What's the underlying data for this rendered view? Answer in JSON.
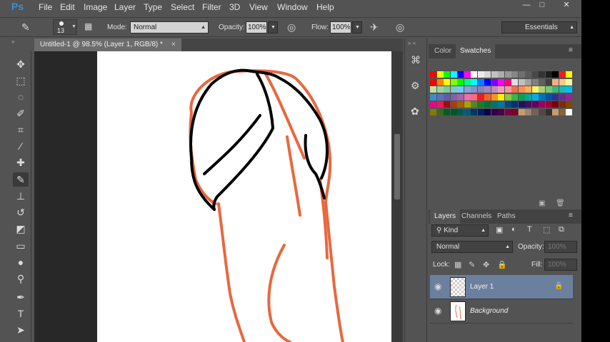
{
  "app": {
    "logo": "Ps"
  },
  "menu": [
    "File",
    "Edit",
    "Image",
    "Layer",
    "Type",
    "Select",
    "Filter",
    "3D",
    "View",
    "Window",
    "Help"
  ],
  "window_controls": {
    "minimize": "—",
    "maximize": "□",
    "close": "✕"
  },
  "options": {
    "brush_size": "13",
    "mode_label": "Mode:",
    "mode_value": "Normal",
    "opacity_label": "Opacity:",
    "opacity_value": "100%",
    "flow_label": "Flow:",
    "flow_value": "100%",
    "workspace": "Essentials"
  },
  "document": {
    "tab_title": "Untitled-1 @ 98.5% (Layer 1, RGB/8) *",
    "close": "×"
  },
  "panels": {
    "color_tab": "Color",
    "swatches_tab": "Swatches",
    "layers_tab": "Layers",
    "channels_tab": "Channels",
    "paths_tab": "Paths",
    "kind_label": "Kind",
    "blend_mode": "Normal",
    "opacity_label": "Opacity:",
    "opacity_value": "100%",
    "lock_label": "Lock:",
    "fill_label": "Fill:",
    "fill_value": "100%"
  },
  "layers": [
    {
      "name": "Layer 1",
      "selected": true
    },
    {
      "name": "Background",
      "selected": false
    }
  ],
  "colors": {
    "accent_selected_layer": "#6b7f9e",
    "stroke_orange": "#e8683f",
    "stroke_black": "#000000"
  },
  "swatch_rows": [
    [
      "#ff0000",
      "#ffff00",
      "#00ff00",
      "#00ffff",
      "#0000ff",
      "#ff00ff",
      "#ffffff",
      "#ebebeb",
      "#d6d6d6",
      "#c2c2c2",
      "#adadad",
      "#999999",
      "#858585",
      "#707070",
      "#5c5c5c",
      "#474747",
      "#333333",
      "#1e1e1e",
      "#000000",
      "#ed1c24",
      "#ffff00"
    ],
    [
      "#ff0000",
      "#ff8000",
      "#ffff00",
      "#80ff00",
      "#00ff00",
      "#00ff80",
      "#00ffff",
      "#0080ff",
      "#0000ff",
      "#8000ff",
      "#ff00ff",
      "#ff0080",
      "#e0e0e0",
      "#c0c0c0",
      "#a0a0a0",
      "#808080",
      "#606060",
      "#404040",
      "#f9ad81",
      "#fdc68a",
      "#fff79a"
    ],
    [
      "#c4df9b",
      "#a3d39c",
      "#82ca9d",
      "#7accc8",
      "#6dcff6",
      "#7da7d8",
      "#8393ca",
      "#8781bd",
      "#a187be",
      "#bd8cbf",
      "#f49ac1",
      "#f5989d",
      "#f26c4f",
      "#f68e56",
      "#fbaf5d",
      "#fff467",
      "#acd373",
      "#7cc576",
      "#3bb878",
      "#1abbb4",
      "#00bff3"
    ],
    [
      "#438ccb",
      "#5574b9",
      "#605ca8",
      "#855fa8",
      "#a763a8",
      "#f06eaa",
      "#f26d7d",
      "#ed1c24",
      "#f26522",
      "#f7941d",
      "#fff200",
      "#8dc63f",
      "#39b54a",
      "#00a651",
      "#00a99d",
      "#00aeef",
      "#0072bc",
      "#0054a6",
      "#2e3192",
      "#662d91",
      "#92278f"
    ],
    [
      "#ec008c",
      "#ed145b",
      "#9e0b0f",
      "#a0410d",
      "#a36209",
      "#aba000",
      "#598527",
      "#1a7b30",
      "#007236",
      "#00746b",
      "#0076a3",
      "#004a80",
      "#003471",
      "#1b1464",
      "#440e62",
      "#630460",
      "#9e005d",
      "#9e0039",
      "#790000",
      "#7b2e00",
      "#7d4900"
    ],
    [
      "#827b00",
      "#406618",
      "#005e20",
      "#005826",
      "#005952",
      "#005b7f",
      "#003663",
      "#002157",
      "#0d004c",
      "#32004b",
      "#4b0049",
      "#7b0046",
      "#7a0026",
      "#c69c6d",
      "#998675",
      "#736357",
      "#534741",
      "#362f2d",
      "#c69c6d",
      "#8c6239",
      "#ffffff"
    ]
  ]
}
